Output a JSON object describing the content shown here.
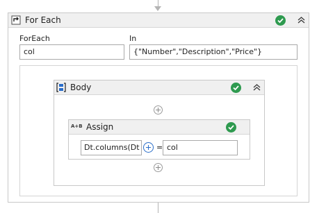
{
  "colors": {
    "success": "#2e9a4f",
    "accent_blue": "#2a6dc9",
    "header_bg": "#f0f0f0",
    "border": "#c8c8c8"
  },
  "for_each": {
    "title": "For Each",
    "icon": "foreach-icon",
    "status": "valid",
    "foreach_label": "ForEach",
    "foreach_value": "col",
    "in_label": "In",
    "in_value": "{\"Number\",\"Description\",\"Price\"}"
  },
  "body": {
    "title": "Body",
    "icon": "sequence-icon",
    "status": "valid"
  },
  "assign": {
    "title": "Assign",
    "icon_text": "A+B",
    "status": "valid",
    "to_value": "Dt.columns(Dt",
    "equals": "=",
    "value": "col"
  }
}
